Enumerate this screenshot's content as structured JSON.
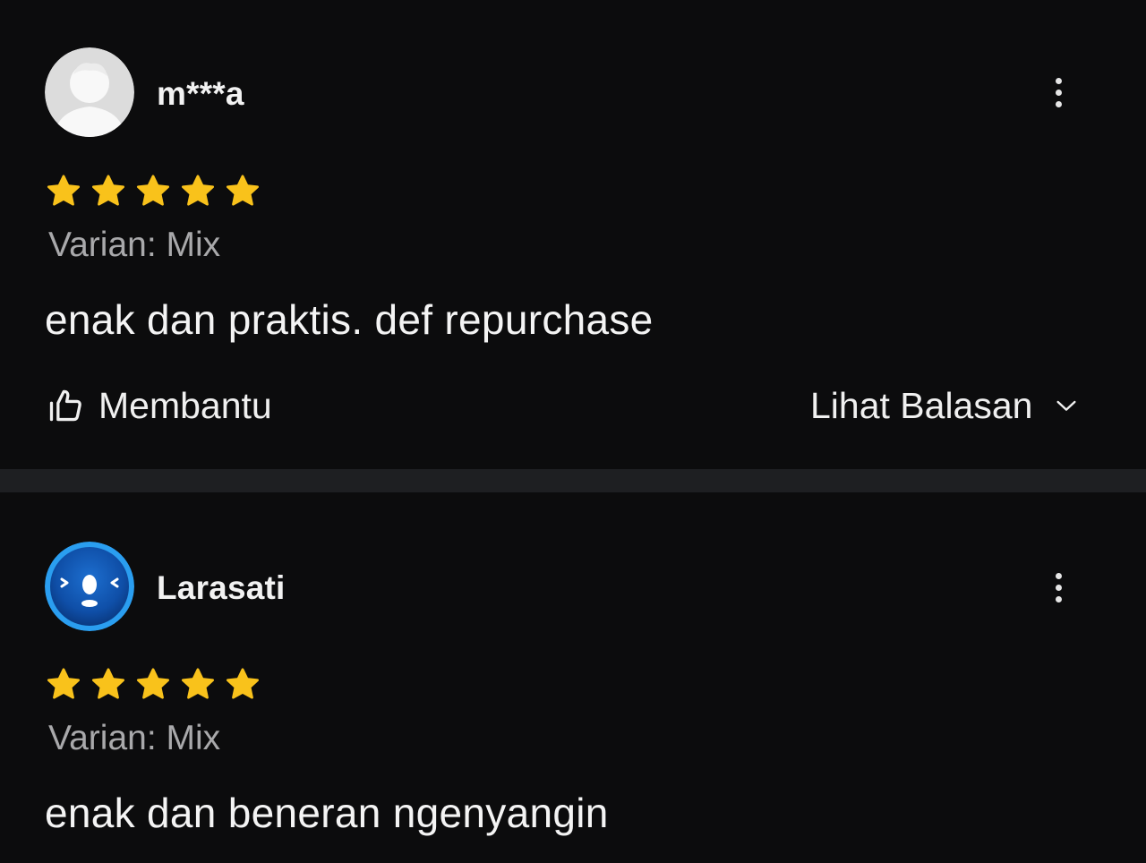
{
  "reviews": [
    {
      "username": "m***a",
      "avatar_icon": "default-user-avatar-icon",
      "rating": 5,
      "rating_max": 5,
      "variant": "Varian: Mix",
      "comment": "enak dan praktis. def repurchase",
      "helpful_label": "Membantu",
      "view_replies_label": "Lihat Balasan"
    },
    {
      "username": "Larasati",
      "avatar_icon": "blue-robot-avatar-icon",
      "rating": 5,
      "rating_max": 5,
      "variant": "Varian: Mix",
      "comment": "enak dan beneran ngenyangin"
    }
  ],
  "colors": {
    "background": "#0c0c0d",
    "separator": "#1e1f22",
    "star": "#f9c21b",
    "text_primary": "#f2f2f2",
    "text_secondary": "#a9a9ab"
  }
}
